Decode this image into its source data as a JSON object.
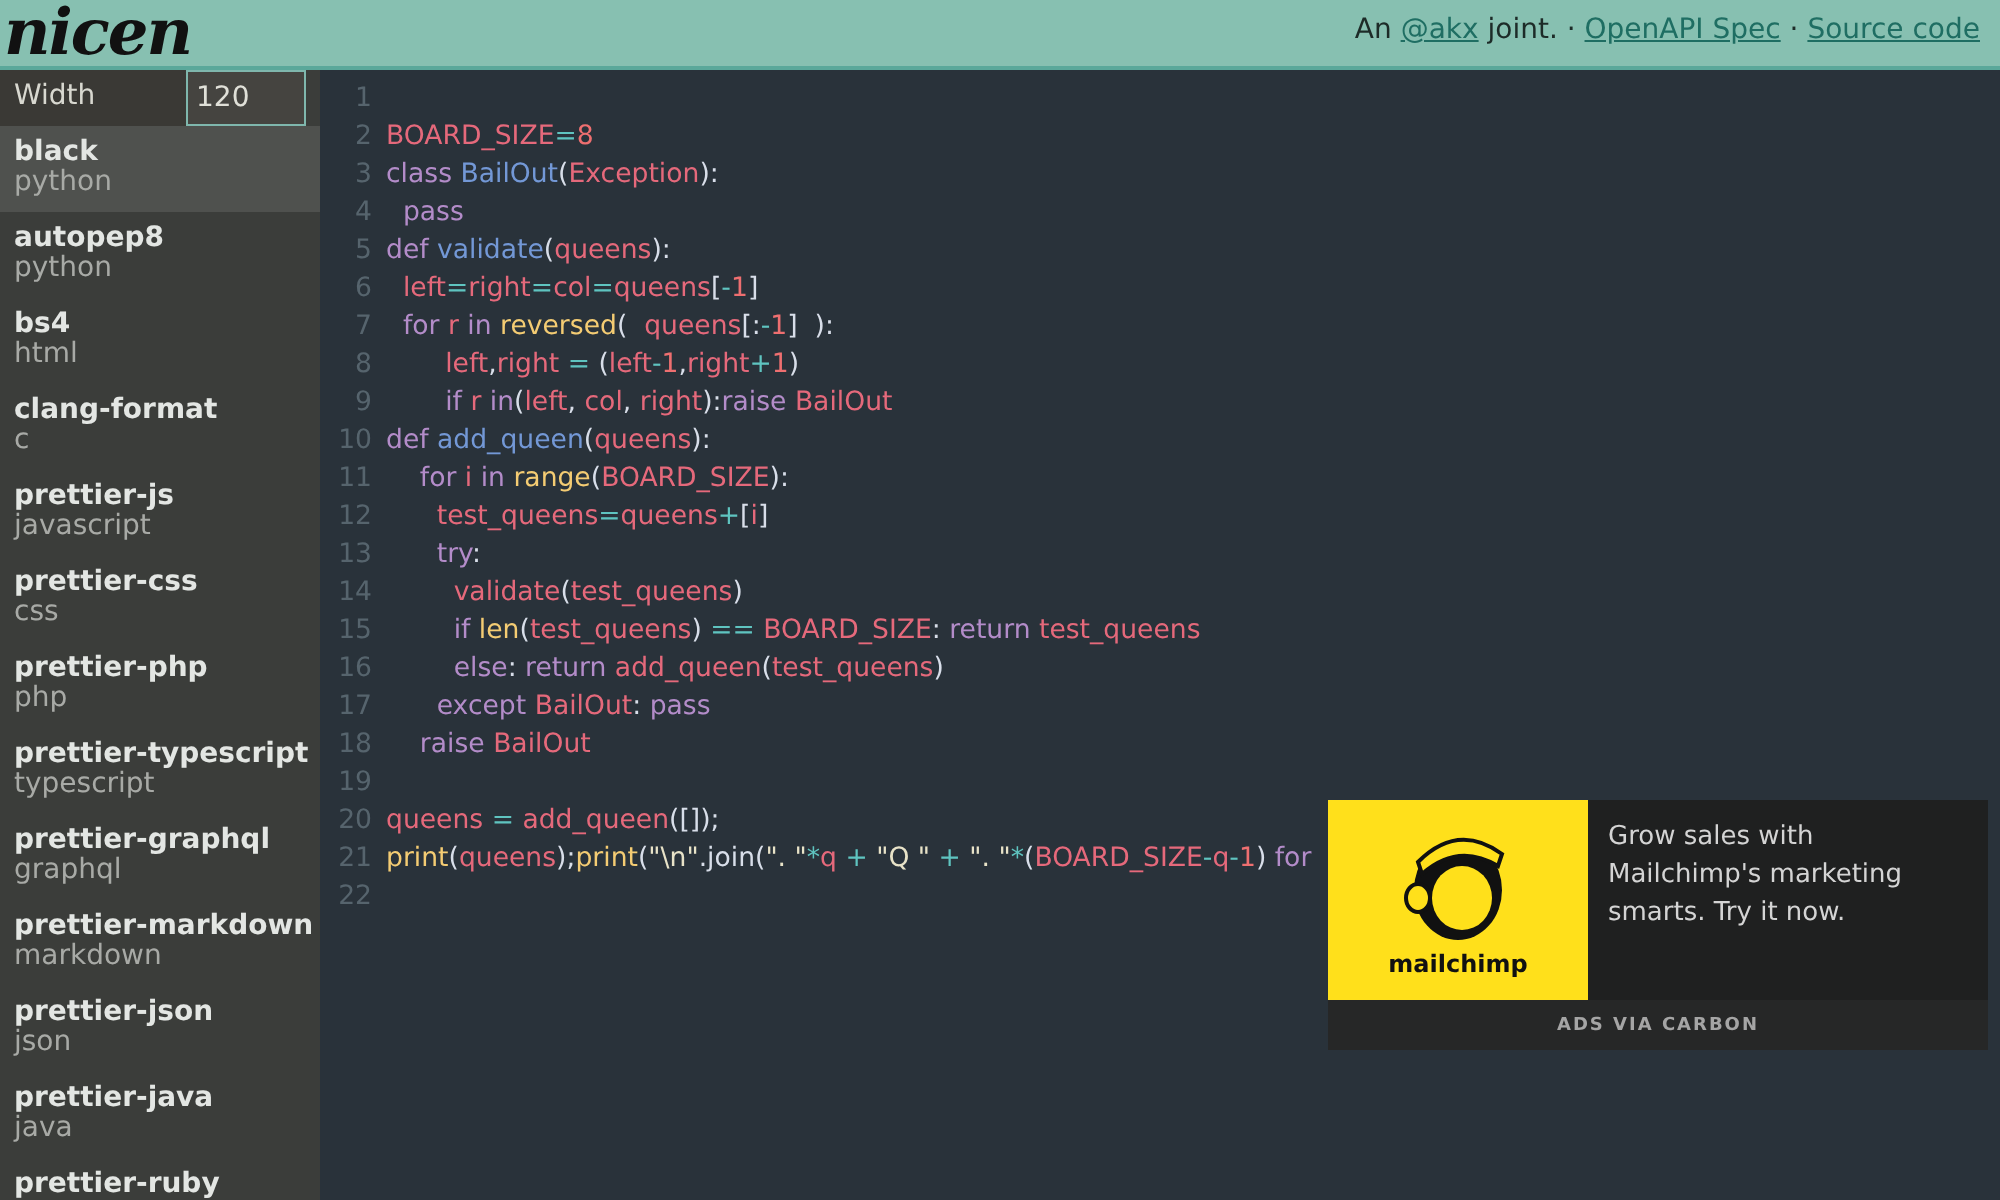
{
  "header": {
    "logo": "nicen",
    "credit_prefix": "An ",
    "author_link": "@akx",
    "credit_suffix": " joint.",
    "separator_1": " · ",
    "spec_link": "OpenAPI Spec",
    "separator_2": " · ",
    "source_link": "Source code"
  },
  "sidebar": {
    "width_label": "Width",
    "width_value": "120",
    "items": [
      {
        "name": "black",
        "language": "python",
        "selected": true
      },
      {
        "name": "autopep8",
        "language": "python",
        "selected": false
      },
      {
        "name": "bs4",
        "language": "html",
        "selected": false
      },
      {
        "name": "clang-format",
        "language": "c",
        "selected": false
      },
      {
        "name": "prettier-js",
        "language": "javascript",
        "selected": false
      },
      {
        "name": "prettier-css",
        "language": "css",
        "selected": false
      },
      {
        "name": "prettier-php",
        "language": "php",
        "selected": false
      },
      {
        "name": "prettier-typescript",
        "language": "typescript",
        "selected": false
      },
      {
        "name": "prettier-graphql",
        "language": "graphql",
        "selected": false
      },
      {
        "name": "prettier-markdown",
        "language": "markdown",
        "selected": false
      },
      {
        "name": "prettier-json",
        "language": "json",
        "selected": false
      },
      {
        "name": "prettier-java",
        "language": "java",
        "selected": false
      },
      {
        "name": "prettier-ruby",
        "selected": false
      }
    ]
  },
  "code": {
    "lines": [
      {
        "number": "1"
      },
      {
        "number": "2",
        "tokens": [
          {
            "kind": "var",
            "text": "BOARD_SIZE"
          },
          {
            "kind": "op",
            "text": "="
          },
          {
            "kind": "num",
            "text": "8"
          }
        ]
      },
      {
        "number": "3",
        "tokens": [
          {
            "kind": "kw",
            "text": "class "
          },
          {
            "kind": "fn",
            "text": "BailOut"
          },
          {
            "kind": "punct",
            "text": "("
          },
          {
            "kind": "var",
            "text": "Exception"
          },
          {
            "kind": "punct",
            "text": "):"
          }
        ]
      },
      {
        "number": "4",
        "tokens": [
          {
            "kind": "kw",
            "text": "  pass"
          }
        ]
      },
      {
        "number": "5",
        "tokens": [
          {
            "kind": "kw",
            "text": "def "
          },
          {
            "kind": "fn",
            "text": "validate"
          },
          {
            "kind": "punct",
            "text": "("
          },
          {
            "kind": "var",
            "text": "queens"
          },
          {
            "kind": "punct",
            "text": "):"
          }
        ]
      },
      {
        "number": "6",
        "tokens": [
          {
            "kind": "var",
            "text": "  left"
          },
          {
            "kind": "op",
            "text": "="
          },
          {
            "kind": "var",
            "text": "right"
          },
          {
            "kind": "op",
            "text": "="
          },
          {
            "kind": "var",
            "text": "col"
          },
          {
            "kind": "op",
            "text": "="
          },
          {
            "kind": "var",
            "text": "queens"
          },
          {
            "kind": "punct",
            "text": "["
          },
          {
            "kind": "op",
            "text": "-"
          },
          {
            "kind": "num",
            "text": "1"
          },
          {
            "kind": "punct",
            "text": "]"
          }
        ]
      },
      {
        "number": "7",
        "tokens": [
          {
            "kind": "kw",
            "text": "  for "
          },
          {
            "kind": "var",
            "text": "r"
          },
          {
            "kind": "kw",
            "text": " in "
          },
          {
            "kind": "builtin",
            "text": "reversed"
          },
          {
            "kind": "punct",
            "text": "(  "
          },
          {
            "kind": "var",
            "text": "queens"
          },
          {
            "kind": "punct",
            "text": "[:"
          },
          {
            "kind": "op",
            "text": "-"
          },
          {
            "kind": "num",
            "text": "1"
          },
          {
            "kind": "punct",
            "text": "]  ):"
          }
        ]
      },
      {
        "number": "8",
        "tokens": [
          {
            "kind": "var",
            "text": "       left"
          },
          {
            "kind": "punct",
            "text": ","
          },
          {
            "kind": "var",
            "text": "right"
          },
          {
            "kind": "op",
            "text": " = "
          },
          {
            "kind": "punct",
            "text": "("
          },
          {
            "kind": "var",
            "text": "left"
          },
          {
            "kind": "op",
            "text": "-"
          },
          {
            "kind": "num",
            "text": "1"
          },
          {
            "kind": "punct",
            "text": ","
          },
          {
            "kind": "var",
            "text": "right"
          },
          {
            "kind": "op",
            "text": "+"
          },
          {
            "kind": "num",
            "text": "1"
          },
          {
            "kind": "punct",
            "text": ")"
          }
        ]
      },
      {
        "number": "9",
        "tokens": [
          {
            "kind": "kw",
            "text": "       if "
          },
          {
            "kind": "var",
            "text": "r"
          },
          {
            "kind": "kw",
            "text": " in"
          },
          {
            "kind": "punct",
            "text": "("
          },
          {
            "kind": "var",
            "text": "left"
          },
          {
            "kind": "punct",
            "text": ", "
          },
          {
            "kind": "var",
            "text": "col"
          },
          {
            "kind": "punct",
            "text": ", "
          },
          {
            "kind": "var",
            "text": "right"
          },
          {
            "kind": "punct",
            "text": "):"
          },
          {
            "kind": "kw",
            "text": "raise "
          },
          {
            "kind": "var",
            "text": "BailOut"
          }
        ]
      },
      {
        "number": "10",
        "tokens": [
          {
            "kind": "kw",
            "text": "def "
          },
          {
            "kind": "fn",
            "text": "add_queen"
          },
          {
            "kind": "punct",
            "text": "("
          },
          {
            "kind": "var",
            "text": "queens"
          },
          {
            "kind": "punct",
            "text": "):"
          }
        ]
      },
      {
        "number": "11",
        "tokens": [
          {
            "kind": "kw",
            "text": "    for "
          },
          {
            "kind": "var",
            "text": "i"
          },
          {
            "kind": "kw",
            "text": " in "
          },
          {
            "kind": "builtin",
            "text": "range"
          },
          {
            "kind": "punct",
            "text": "("
          },
          {
            "kind": "var",
            "text": "BOARD_SIZE"
          },
          {
            "kind": "punct",
            "text": "):"
          }
        ]
      },
      {
        "number": "12",
        "tokens": [
          {
            "kind": "var",
            "text": "      test_queens"
          },
          {
            "kind": "op",
            "text": "="
          },
          {
            "kind": "var",
            "text": "queens"
          },
          {
            "kind": "op",
            "text": "+"
          },
          {
            "kind": "punct",
            "text": "["
          },
          {
            "kind": "var",
            "text": "i"
          },
          {
            "kind": "punct",
            "text": "]"
          }
        ]
      },
      {
        "number": "13",
        "tokens": [
          {
            "kind": "kw",
            "text": "      try"
          },
          {
            "kind": "punct",
            "text": ":"
          }
        ]
      },
      {
        "number": "14",
        "tokens": [
          {
            "kind": "var",
            "text": "        validate"
          },
          {
            "kind": "punct",
            "text": "("
          },
          {
            "kind": "var",
            "text": "test_queens"
          },
          {
            "kind": "punct",
            "text": ")"
          }
        ]
      },
      {
        "number": "15",
        "tokens": [
          {
            "kind": "kw",
            "text": "        if "
          },
          {
            "kind": "builtin",
            "text": "len"
          },
          {
            "kind": "punct",
            "text": "("
          },
          {
            "kind": "var",
            "text": "test_queens"
          },
          {
            "kind": "punct",
            "text": ") "
          },
          {
            "kind": "op",
            "text": "== "
          },
          {
            "kind": "var",
            "text": "BOARD_SIZE"
          },
          {
            "kind": "punct",
            "text": ": "
          },
          {
            "kind": "kw",
            "text": "return "
          },
          {
            "kind": "var",
            "text": "test_queens"
          }
        ]
      },
      {
        "number": "16",
        "tokens": [
          {
            "kind": "kw",
            "text": "        else"
          },
          {
            "kind": "punct",
            "text": ": "
          },
          {
            "kind": "kw",
            "text": "return "
          },
          {
            "kind": "var",
            "text": "add_queen"
          },
          {
            "kind": "punct",
            "text": "("
          },
          {
            "kind": "var",
            "text": "test_queens"
          },
          {
            "kind": "punct",
            "text": ")"
          }
        ]
      },
      {
        "number": "17",
        "tokens": [
          {
            "kind": "kw",
            "text": "      except "
          },
          {
            "kind": "var",
            "text": "BailOut"
          },
          {
            "kind": "punct",
            "text": ": "
          },
          {
            "kind": "kw",
            "text": "pass"
          }
        ]
      },
      {
        "number": "18",
        "tokens": [
          {
            "kind": "kw",
            "text": "    raise "
          },
          {
            "kind": "var",
            "text": "BailOut"
          }
        ]
      },
      {
        "number": "19"
      },
      {
        "number": "20",
        "tokens": [
          {
            "kind": "var",
            "text": "queens"
          },
          {
            "kind": "op",
            "text": " = "
          },
          {
            "kind": "var",
            "text": "add_queen"
          },
          {
            "kind": "punct",
            "text": "([]);"
          }
        ]
      },
      {
        "number": "21",
        "tokens": [
          {
            "kind": "builtin",
            "text": "print"
          },
          {
            "kind": "punct",
            "text": "("
          },
          {
            "kind": "var",
            "text": "queens"
          },
          {
            "kind": "punct",
            "text": ");"
          },
          {
            "kind": "builtin",
            "text": "print"
          },
          {
            "kind": "punct",
            "text": "("
          },
          {
            "kind": "str",
            "text": "\"\\n\""
          },
          {
            "kind": "punct",
            "text": ".join("
          },
          {
            "kind": "str",
            "text": "\". \""
          },
          {
            "kind": "op",
            "text": "*"
          },
          {
            "kind": "var",
            "text": "q"
          },
          {
            "kind": "op",
            "text": " + "
          },
          {
            "kind": "str",
            "text": "\"Q \""
          },
          {
            "kind": "op",
            "text": " + "
          },
          {
            "kind": "str",
            "text": "\". \""
          },
          {
            "kind": "op",
            "text": "*"
          },
          {
            "kind": "punct",
            "text": "("
          },
          {
            "kind": "var",
            "text": "BOARD_SIZE"
          },
          {
            "kind": "op",
            "text": "-"
          },
          {
            "kind": "var",
            "text": "q"
          },
          {
            "kind": "op",
            "text": "-"
          },
          {
            "kind": "num",
            "text": "1"
          },
          {
            "kind": "punct",
            "text": ") "
          },
          {
            "kind": "kw",
            "text": "for"
          }
        ]
      },
      {
        "number": "22"
      }
    ]
  },
  "ad": {
    "brand": "mailchimp",
    "text": "Grow sales with Mailchimp's marketing smarts. Try it now.",
    "footer": "ADS VIA CARBON"
  }
}
